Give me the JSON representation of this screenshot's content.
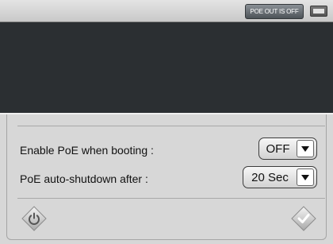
{
  "statusbar": {
    "poe_button_label": "POE OUT IS OFF",
    "battery_icon": "battery-icon"
  },
  "panel": {
    "settings": [
      {
        "label": "Enable PoE when booting :",
        "value": "OFF"
      },
      {
        "label": "PoE auto-shutdown after :",
        "value": "20 Sec"
      }
    ],
    "power_icon": "power-icon",
    "confirm_icon": "checkmark-icon"
  },
  "colors": {
    "background_dark": "#2b2f32",
    "panel": "#d7d7d7",
    "topbar": "#d6d6d6"
  }
}
